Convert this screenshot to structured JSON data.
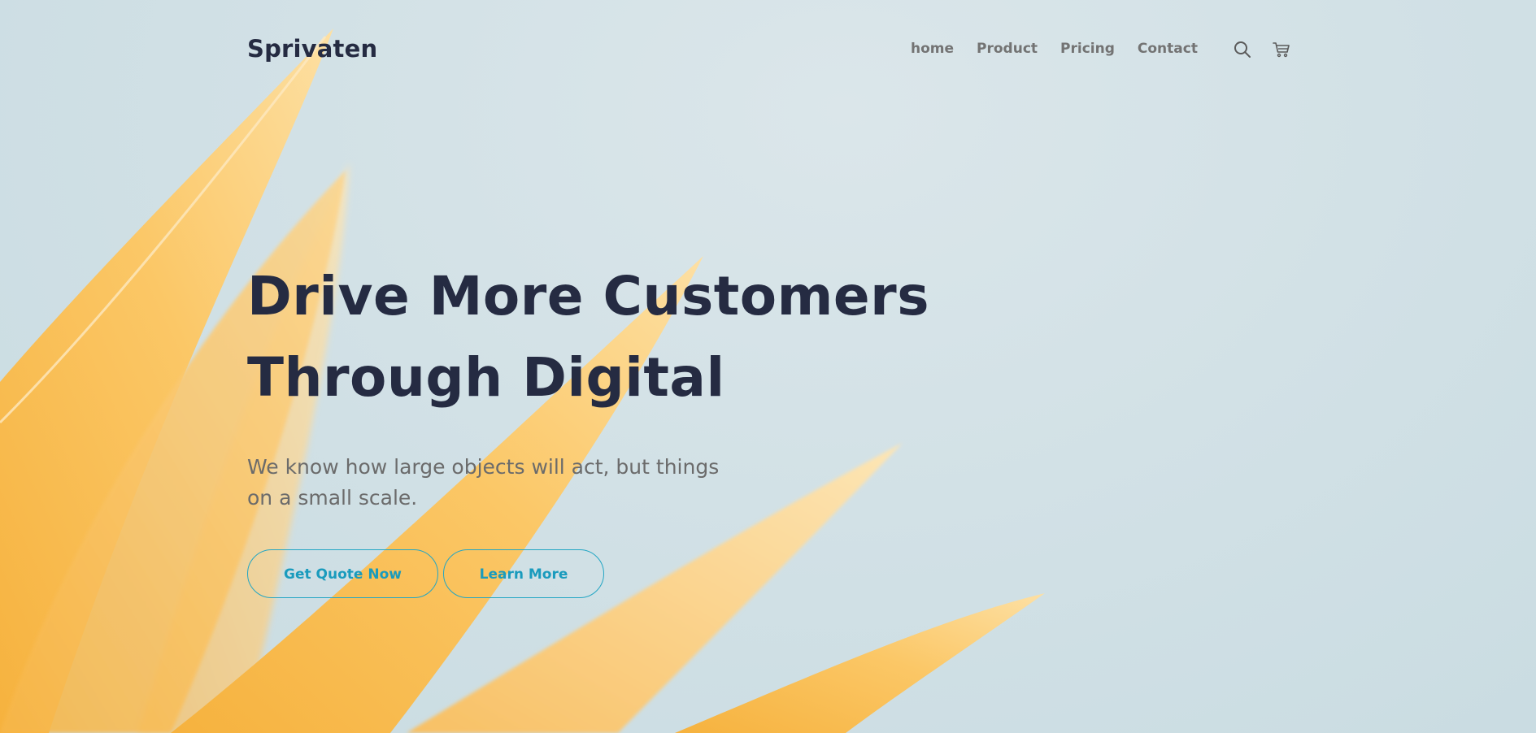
{
  "header": {
    "brand": "Sprivaten",
    "nav": [
      "home",
      "Product",
      "Pricing",
      "Contact"
    ],
    "icons": [
      "search-icon",
      "cart-icon"
    ]
  },
  "hero": {
    "title_lines": [
      "Drive More Customers",
      "Through Digital"
    ],
    "subtitle_lines": [
      "We know how large objects will act, but things",
      "on a small scale."
    ],
    "buttons": {
      "primary": "Get Quote Now",
      "secondary": "Learn More"
    }
  },
  "colors": {
    "background": "#d3e2e7",
    "title": "#252b42",
    "nav_text": "#737373",
    "subtitle": "#6b6b6b",
    "accent": "#23a6c4",
    "petal": "#f9bd57"
  }
}
